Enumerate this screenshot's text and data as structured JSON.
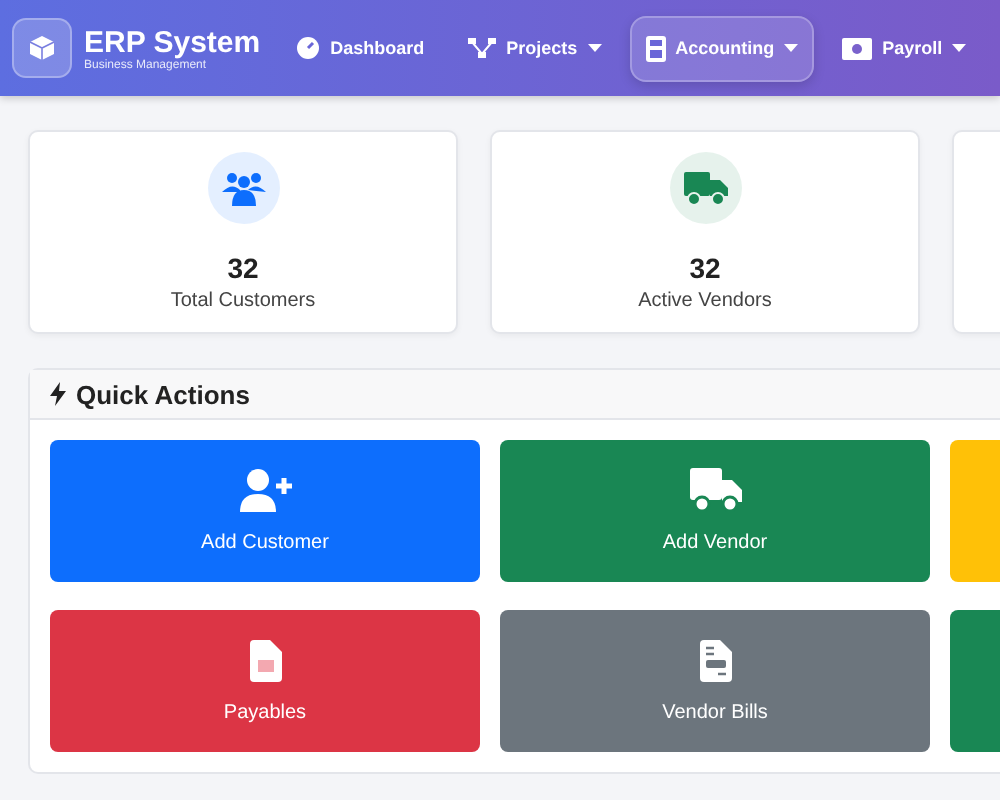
{
  "brand": {
    "title": "ERP System",
    "subtitle": "Business Management"
  },
  "nav": [
    {
      "label": "Dashboard",
      "selected": false,
      "dropdown": false
    },
    {
      "label": "Projects",
      "selected": false,
      "dropdown": true
    },
    {
      "label": "Accounting",
      "selected": true,
      "dropdown": true
    },
    {
      "label": "Payroll",
      "selected": false,
      "dropdown": true
    }
  ],
  "stats": [
    {
      "kind": "stat",
      "value": "32",
      "label": "Total Customers",
      "color": "#0d6efd"
    },
    {
      "kind": "stat",
      "value": "32",
      "label": "Active Vendors",
      "color": "#198754"
    },
    {
      "kind": "blank"
    }
  ],
  "quick_actions": {
    "title": "Quick Actions",
    "actions": [
      {
        "label": "Add Customer",
        "color": "#0d6efd"
      },
      {
        "label": "Add Vendor",
        "color": "#198754"
      },
      {
        "color": "#ffc107"
      },
      {
        "label": "Payables",
        "color": "#dc3545"
      },
      {
        "label": "Vendor Bills",
        "color": "#6c757d"
      },
      {
        "color": "#198754"
      }
    ]
  }
}
